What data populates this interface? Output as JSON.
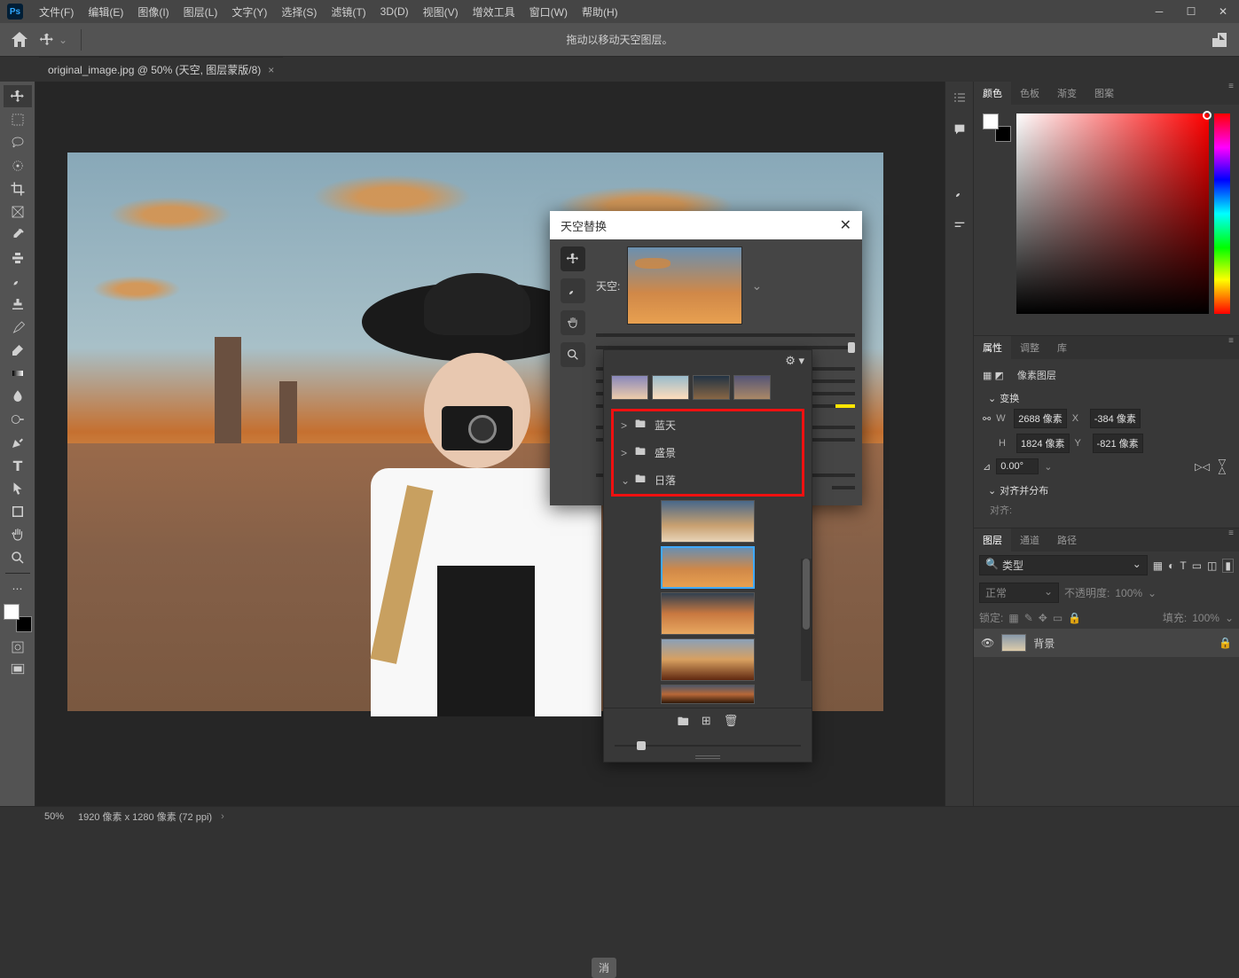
{
  "menu": {
    "items": [
      "文件(F)",
      "编辑(E)",
      "图像(I)",
      "图层(L)",
      "文字(Y)",
      "选择(S)",
      "滤镜(T)",
      "3D(D)",
      "视图(V)",
      "增效工具",
      "窗口(W)",
      "帮助(H)"
    ]
  },
  "options_hint": "拖动以移动天空图层。",
  "doc_tab": "original_image.jpg @ 50% (天空, 图层蒙版/8)",
  "sky_dialog": {
    "title": "天空替换",
    "sky_label": "天空:",
    "cancel": "消"
  },
  "sky_popup": {
    "folders": [
      {
        "caret": ">",
        "name": "蓝天"
      },
      {
        "caret": ">",
        "name": "盛景"
      },
      {
        "caret": "⌄",
        "name": "日落"
      }
    ]
  },
  "color_tabs": [
    "颜色",
    "色板",
    "渐变",
    "图案"
  ],
  "prop_tabs": [
    "属性",
    "调整",
    "库"
  ],
  "prop_type": "像素图层",
  "transform": {
    "head": "变换",
    "W_label": "W",
    "W": "2688",
    "W_unit": "像素",
    "X_label": "X",
    "X": "-384",
    "X_unit": "像素",
    "H_label": "H",
    "H": "1824",
    "H_unit": "像素",
    "Y_label": "Y",
    "Y": "-821",
    "Y_unit": "像素",
    "angle": "0.00°"
  },
  "align_head": "对齐并分布",
  "align_sub": "对齐:",
  "layer_tabs": [
    "图层",
    "通道",
    "路径"
  ],
  "layer_filter": "类型",
  "blend_mode": "正常",
  "opacity_label": "不透明度:",
  "opacity": "100%",
  "lock_label": "锁定:",
  "fill_label": "填充:",
  "fill": "100%",
  "layer_name": "背景",
  "status": {
    "zoom": "50%",
    "dims": "1920 像素 x 1280 像素 (72 ppi)"
  }
}
